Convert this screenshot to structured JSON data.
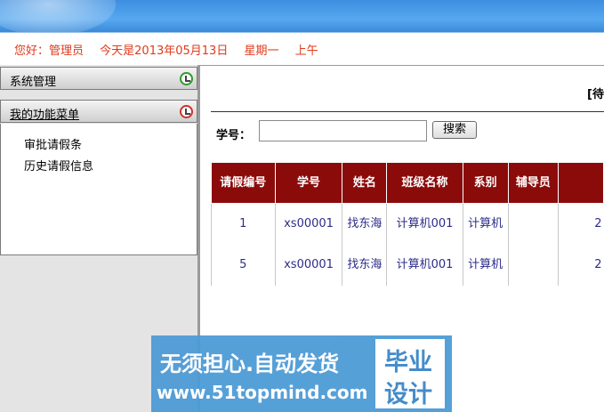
{
  "header": {
    "greeting": "您好：管理员",
    "date": "今天是2013年05月13日",
    "weekday": "星期一",
    "period": "上午"
  },
  "sidebar": {
    "groups": [
      {
        "label": "系统管理",
        "icon": "green-expand-icon"
      },
      {
        "label": "我的功能菜单",
        "icon": "red-collapse-icon"
      }
    ],
    "items": [
      "审批请假条",
      "历史请假信息"
    ]
  },
  "main": {
    "title": "[待",
    "search": {
      "label": "学号：",
      "value": "",
      "button": "搜索"
    },
    "table": {
      "headers": [
        "请假编号",
        "学号",
        "姓名",
        "班级名称",
        "系别",
        "辅导员",
        ""
      ],
      "rows": [
        [
          "1",
          "xs00001",
          "找东海",
          "计算机001",
          "计算机",
          "",
          "2"
        ],
        [
          "5",
          "xs00001",
          "找东海",
          "计算机001",
          "计算机",
          "",
          "2"
        ]
      ]
    }
  },
  "watermark": {
    "line1": "无须担心.自动发货",
    "line2": "www.51topmind.com",
    "box_top": "毕业",
    "box_bottom": "设计"
  },
  "colors": {
    "header_text": "#e0391a",
    "table_header_bg": "#8b0b0b",
    "table_text": "#2c2c8a",
    "banner": "#4a9ae6"
  }
}
